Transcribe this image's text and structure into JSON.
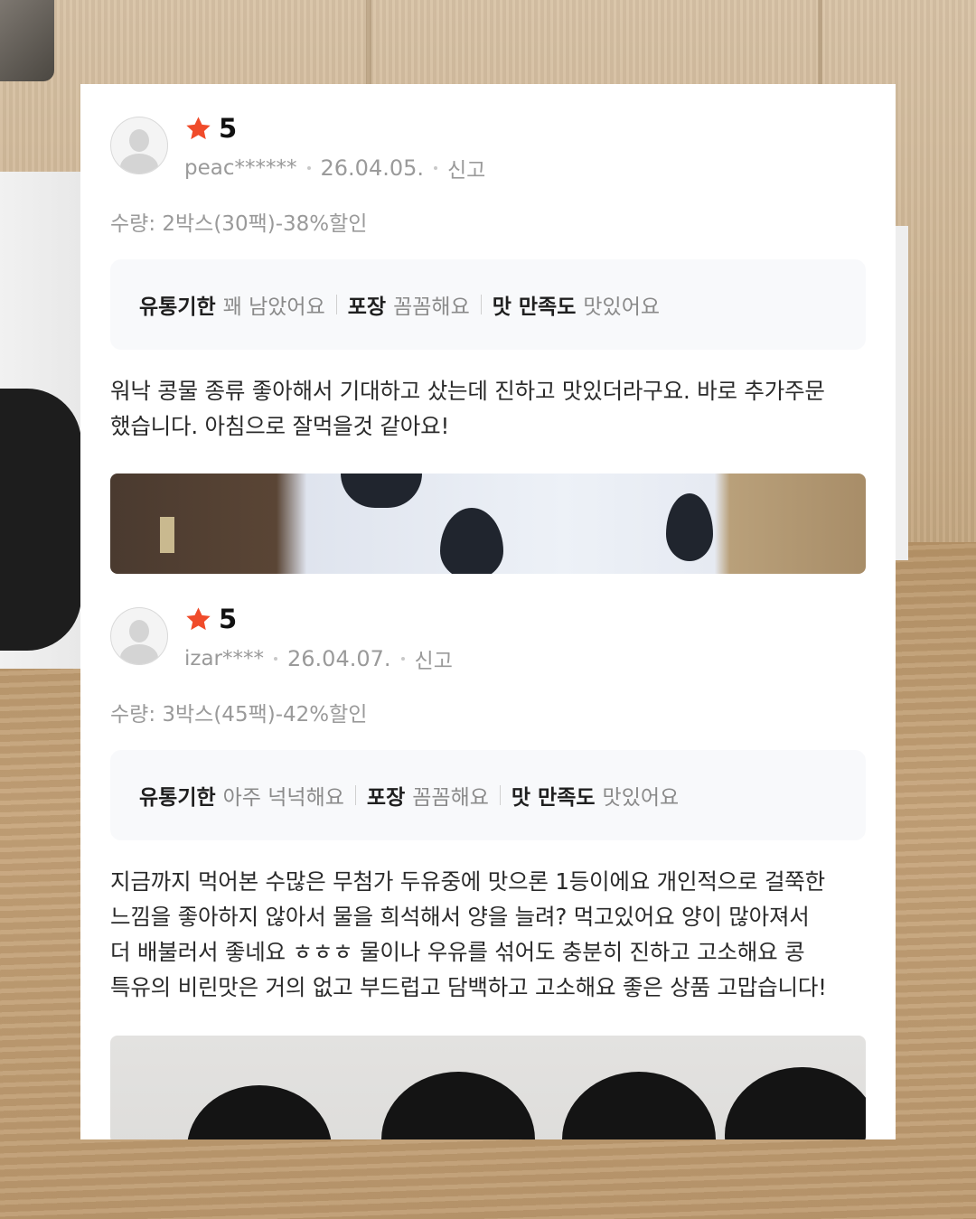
{
  "reviews": [
    {
      "avatar_icon": "default-user-icon",
      "rating_icon": "star-icon",
      "rating": "5",
      "user": "peac******",
      "date": "26.04.05.",
      "report_label": "신고",
      "quantity": "수량: 2박스(30팩)-38%할인",
      "attributes": [
        {
          "key": "유통기한",
          "value": "꽤 남았어요"
        },
        {
          "key": "포장",
          "value": "꼼꼼해요"
        },
        {
          "key": "맛 만족도",
          "value": "맛있어요"
        }
      ],
      "text_line1": "워낙 콩물 종류 좋아해서 기대하고 샀는데 진하고 맛있더라구요. 바로 추가주문",
      "text_line2": "했습니다. 아침으로 잘먹을것 같아요!"
    },
    {
      "avatar_icon": "default-user-icon",
      "rating_icon": "star-icon",
      "rating": "5",
      "user": "izar****",
      "date": "26.04.07.",
      "report_label": "신고",
      "quantity": "수량: 3박스(45팩)-42%할인",
      "attributes": [
        {
          "key": "유통기한",
          "value": "아주 넉넉해요"
        },
        {
          "key": "포장",
          "value": "꼼꼼해요"
        },
        {
          "key": "맛 만족도",
          "value": "맛있어요"
        }
      ],
      "text_line1": "지금까지 먹어본 수많은 무첨가 두유중에 맛으론 1등이에요 개인적으로 걸쭉한",
      "text_line2": "느낌을 좋아하지 않아서 물을 희석해서 양을 늘려? 먹고있어요 양이 많아져서",
      "text_line3": "더 배불러서 좋네요 ㅎㅎㅎ 물이나 우유를 섞어도 충분히 진하고 고소해요 콩",
      "text_line4": "특유의 비린맛은 거의 없고 부드럽고 담백하고 고소해요 좋은 상품 고맙습니다!"
    }
  ],
  "colors": {
    "star": "#f04b2a",
    "muted_text": "#9a9a9a",
    "body_text": "#2a2a2a",
    "attr_bg": "#f8f9fb"
  }
}
